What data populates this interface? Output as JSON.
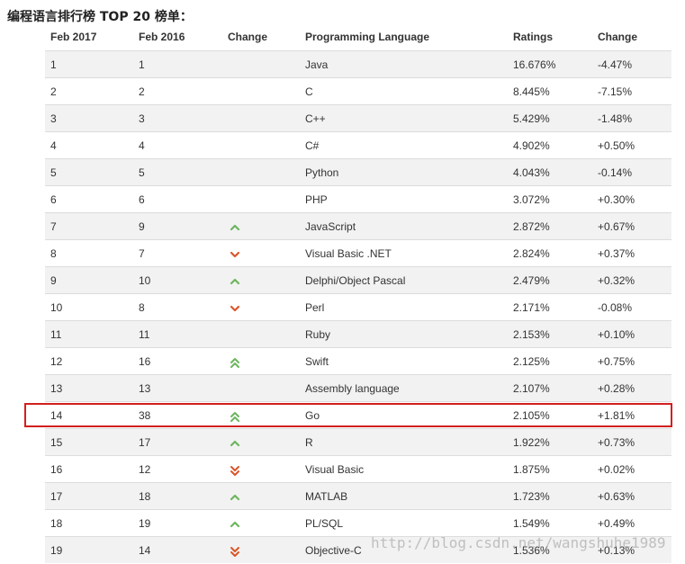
{
  "title": "编程语言排行榜 TOP 20 榜单：",
  "columns": {
    "rank_now": "Feb 2017",
    "rank_prev": "Feb 2016",
    "change": "Change",
    "language": "Programming Language",
    "ratings": "Ratings",
    "delta": "Change"
  },
  "rows": [
    {
      "now": "1",
      "prev": "1",
      "trend": "none",
      "language": "Java",
      "rating": "16.676%",
      "delta": "-4.47%"
    },
    {
      "now": "2",
      "prev": "2",
      "trend": "none",
      "language": "C",
      "rating": "8.445%",
      "delta": "-7.15%"
    },
    {
      "now": "3",
      "prev": "3",
      "trend": "none",
      "language": "C++",
      "rating": "5.429%",
      "delta": "-1.48%"
    },
    {
      "now": "4",
      "prev": "4",
      "trend": "none",
      "language": "C#",
      "rating": "4.902%",
      "delta": "+0.50%"
    },
    {
      "now": "5",
      "prev": "5",
      "trend": "none",
      "language": "Python",
      "rating": "4.043%",
      "delta": "-0.14%"
    },
    {
      "now": "6",
      "prev": "6",
      "trend": "none",
      "language": "PHP",
      "rating": "3.072%",
      "delta": "+0.30%"
    },
    {
      "now": "7",
      "prev": "9",
      "trend": "up",
      "language": "JavaScript",
      "rating": "2.872%",
      "delta": "+0.67%"
    },
    {
      "now": "8",
      "prev": "7",
      "trend": "down",
      "language": "Visual Basic .NET",
      "rating": "2.824%",
      "delta": "+0.37%"
    },
    {
      "now": "9",
      "prev": "10",
      "trend": "up",
      "language": "Delphi/Object Pascal",
      "rating": "2.479%",
      "delta": "+0.32%"
    },
    {
      "now": "10",
      "prev": "8",
      "trend": "down",
      "language": "Perl",
      "rating": "2.171%",
      "delta": "-0.08%"
    },
    {
      "now": "11",
      "prev": "11",
      "trend": "none",
      "language": "Ruby",
      "rating": "2.153%",
      "delta": "+0.10%"
    },
    {
      "now": "12",
      "prev": "16",
      "trend": "double-up",
      "language": "Swift",
      "rating": "2.125%",
      "delta": "+0.75%"
    },
    {
      "now": "13",
      "prev": "13",
      "trend": "none",
      "language": "Assembly language",
      "rating": "2.107%",
      "delta": "+0.28%"
    },
    {
      "now": "14",
      "prev": "38",
      "trend": "double-up",
      "language": "Go",
      "rating": "2.105%",
      "delta": "+1.81%"
    },
    {
      "now": "15",
      "prev": "17",
      "trend": "up",
      "language": "R",
      "rating": "1.922%",
      "delta": "+0.73%"
    },
    {
      "now": "16",
      "prev": "12",
      "trend": "double-down",
      "language": "Visual Basic",
      "rating": "1.875%",
      "delta": "+0.02%"
    },
    {
      "now": "17",
      "prev": "18",
      "trend": "up",
      "language": "MATLAB",
      "rating": "1.723%",
      "delta": "+0.63%"
    },
    {
      "now": "18",
      "prev": "19",
      "trend": "up",
      "language": "PL/SQL",
      "rating": "1.549%",
      "delta": "+0.49%"
    },
    {
      "now": "19",
      "prev": "14",
      "trend": "double-down",
      "language": "Objective-C",
      "rating": "1.536%",
      "delta": "+0.13%"
    }
  ],
  "highlight": {
    "language": "Go",
    "color": "#d21f1f"
  },
  "colors": {
    "up": "#6cb55e",
    "down": "#d9562a",
    "row_alt": "#f2f2f2",
    "border": "#dcdcdc"
  },
  "watermark": "http://blog.csdn.net/wangshuhe1989"
}
